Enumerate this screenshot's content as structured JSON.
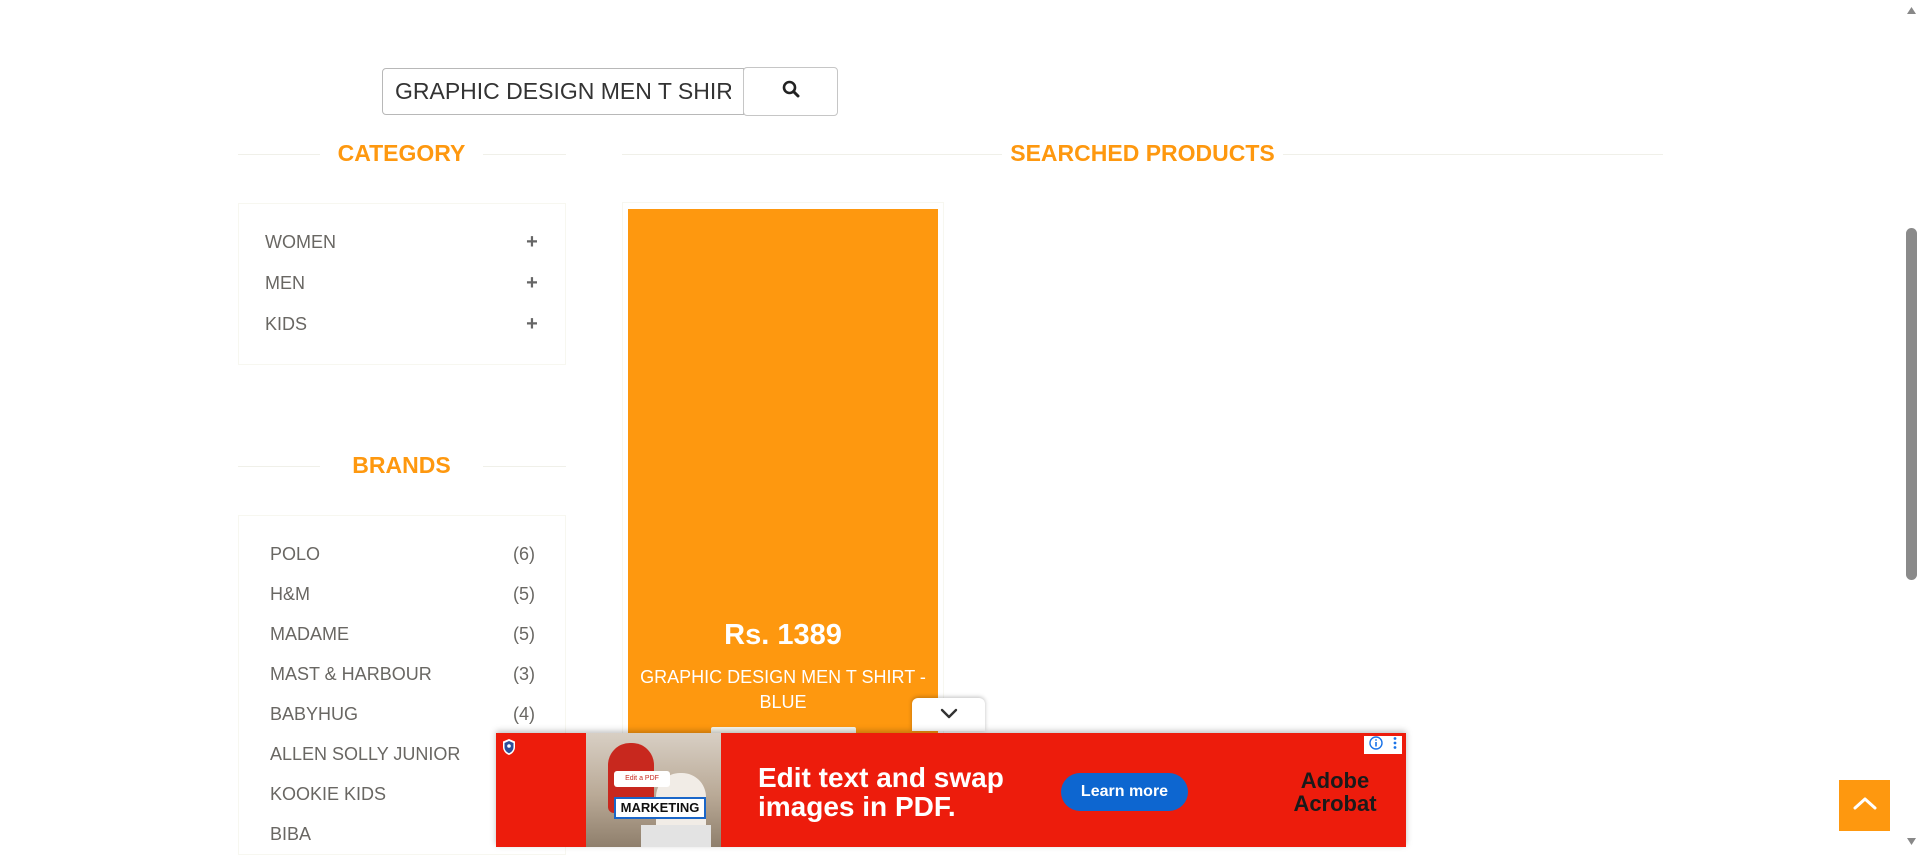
{
  "search": {
    "value": "GRAPHIC DESIGN MEN T SHIRT"
  },
  "category": {
    "title": "CATEGORY",
    "items": [
      {
        "label": "WOMEN",
        "icon": "plus-icon"
      },
      {
        "label": "MEN",
        "icon": "plus-icon"
      },
      {
        "label": "KIDS",
        "icon": "plus-icon"
      }
    ]
  },
  "brands": {
    "title": "BRANDS",
    "items": [
      {
        "label": "POLO",
        "count": "(6)"
      },
      {
        "label": "H&M",
        "count": "(5)"
      },
      {
        "label": "MADAME",
        "count": "(5)"
      },
      {
        "label": "MAST & HARBOUR",
        "count": "(3)"
      },
      {
        "label": "BABYHUG",
        "count": "(4)"
      },
      {
        "label": "ALLEN SOLLY JUNIOR",
        "count": ""
      },
      {
        "label": "KOOKIE KIDS",
        "count": ""
      },
      {
        "label": "BIBA",
        "count": ""
      }
    ]
  },
  "products": {
    "title": "SEARCHED PRODUCTS",
    "items": [
      {
        "price": "Rs. 1389",
        "name": "GRAPHIC DESIGN MEN T SHIRT - BLUE"
      }
    ]
  },
  "ad": {
    "photo_tag_small": "Edit a PDF",
    "photo_tag": "MARKETING",
    "headline": "Edit text and swap images in PDF.",
    "cta": "Learn more",
    "brand": "Adobe Acrobat"
  },
  "colors": {
    "accent": "#fe980f",
    "ad_red": "#ed1c0c",
    "ad_cta_blue": "#0d66d0"
  }
}
